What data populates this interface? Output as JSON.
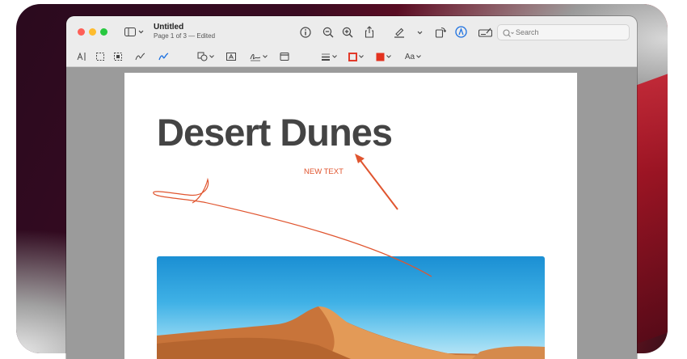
{
  "window": {
    "title": "Untitled",
    "subtitle": "Page 1 of 3 — Edited"
  },
  "search": {
    "placeholder": "Search"
  },
  "markup_toolbar": {
    "text_style_label": "Aa"
  },
  "document": {
    "heading": "Desert Dunes",
    "annotation_text": "NEW TEXT",
    "annotation_color": "#e0552f"
  },
  "icons": {
    "sidebar": "sidebar-icon",
    "info": "info-icon",
    "zoom_out": "zoom-out-icon",
    "zoom_in": "zoom-in-icon",
    "share": "share-icon",
    "highlight": "highlighter-icon",
    "rotate": "rotate-icon",
    "markup": "markup-icon",
    "form": "form-fill-icon"
  },
  "colors": {
    "border_swatch": "#e23a2a",
    "fill_swatch": "#e3321f",
    "markup_accent": "#1a6fe0"
  }
}
